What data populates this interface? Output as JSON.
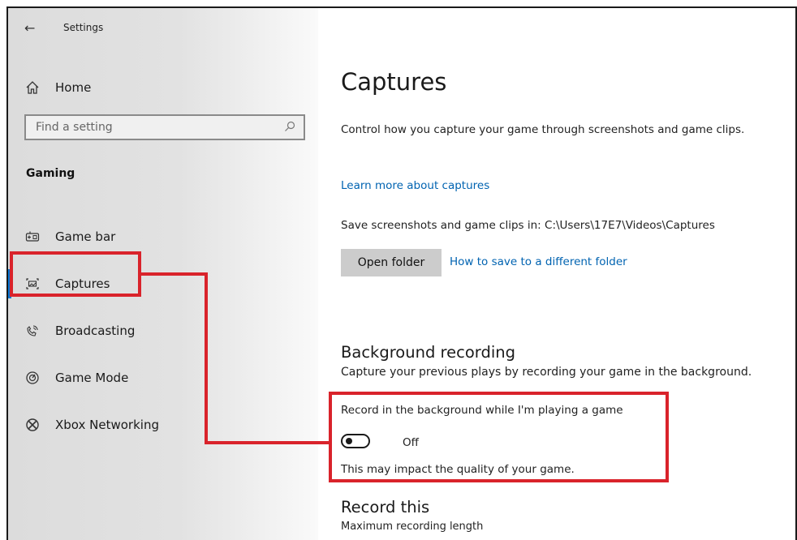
{
  "window": {
    "back_icon": "arrow-left-icon",
    "title": "Settings"
  },
  "sidebar": {
    "home": {
      "label": "Home",
      "icon": "home-icon"
    },
    "search": {
      "placeholder": "Find a setting",
      "icon": "search-icon"
    },
    "section": "Gaming",
    "items": [
      {
        "label": "Game bar",
        "icon": "game-bar-icon",
        "selected": false
      },
      {
        "label": "Captures",
        "icon": "captures-icon",
        "selected": true
      },
      {
        "label": "Broadcasting",
        "icon": "broadcasting-icon",
        "selected": false
      },
      {
        "label": "Game Mode",
        "icon": "game-mode-icon",
        "selected": false
      },
      {
        "label": "Xbox Networking",
        "icon": "xbox-icon",
        "selected": false
      }
    ],
    "accent_color": "#0078d7"
  },
  "main": {
    "title": "Captures",
    "description": "Control how you capture your game through screenshots and game clips.",
    "learn_more": "Learn more about captures",
    "save_path": "Save screenshots and game clips in: C:\\Users\\17E7\\Videos\\Captures",
    "open_folder": "Open folder",
    "how_to_save": "How to save to a different folder",
    "background_recording": {
      "heading": "Background recording",
      "description": "Capture your previous plays by recording your game in the background.",
      "toggle_label": "Record in the background while I'm playing a game",
      "toggle_state": "Off",
      "toggle_on": false,
      "note": "This may impact the quality of your game."
    },
    "record_this": {
      "heading": "Record this",
      "subheading": "Maximum recording length"
    },
    "link_color": "#0063b1"
  },
  "annotation": {
    "color": "#d9232b"
  }
}
